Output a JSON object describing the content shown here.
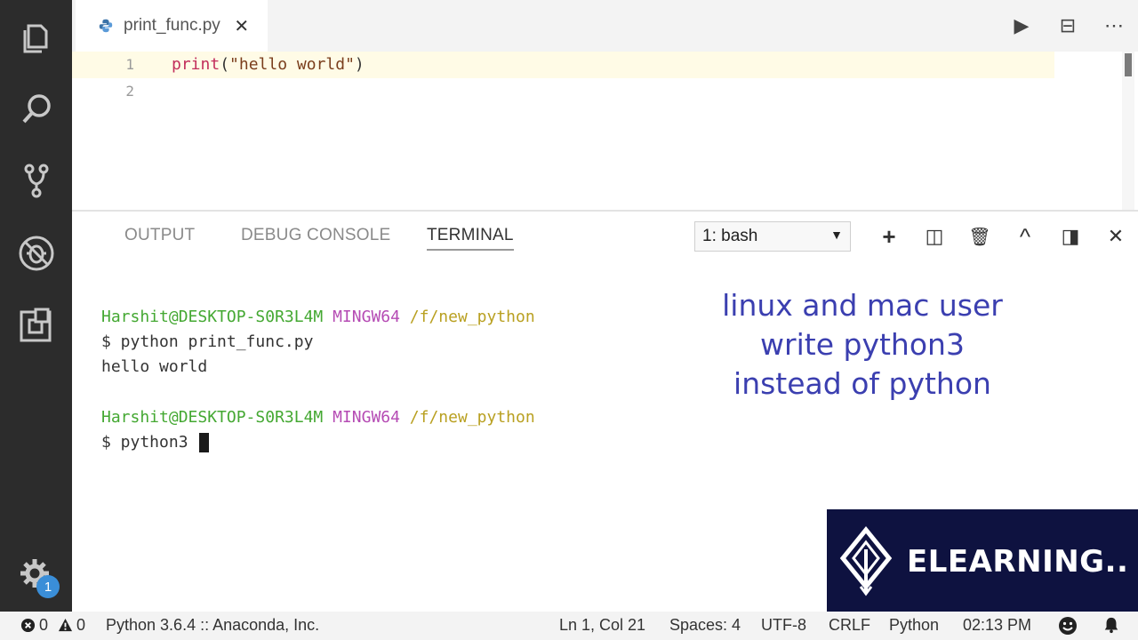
{
  "editor_tab": {
    "filename": "print_func.py",
    "close_glyph": "✕"
  },
  "editor_actions": [
    {
      "name": "run-icon",
      "glyph": "▶"
    },
    {
      "name": "split-editor-icon",
      "glyph": "⊟"
    },
    {
      "name": "more-actions-icon",
      "glyph": "⋯"
    }
  ],
  "editor": {
    "lines": [
      {
        "number": "1",
        "func": "print",
        "open": "(",
        "string": "\"hello world\"",
        "close": ")"
      },
      {
        "number": "2"
      }
    ]
  },
  "panel": {
    "tabs": [
      "OUTPUT",
      "DEBUG CONSOLE",
      "TERMINAL"
    ],
    "active_tab": "TERMINAL",
    "terminal_select": "1: bash",
    "select_caret": "▼"
  },
  "panel_actions": [
    {
      "name": "new-terminal-icon",
      "glyph": "+"
    },
    {
      "name": "split-terminal-icon",
      "glyph": "◫"
    },
    {
      "name": "kill-terminal-icon",
      "glyph": "🗑"
    },
    {
      "name": "maximize-panel-icon",
      "glyph": "^"
    },
    {
      "name": "toggle-panel-position-icon",
      "glyph": "◨"
    },
    {
      "name": "close-panel-icon",
      "glyph": "✕"
    }
  ],
  "terminal": {
    "prompt1": {
      "user": "Harshit@DESKTOP-S0R3L4M",
      "system": "MINGW64",
      "path": "/f/new_python"
    },
    "command1": "$ python print_func.py",
    "output1": "hello world",
    "prompt2": {
      "user": "Harshit@DESKTOP-S0R3L4M",
      "system": "MINGW64",
      "path": "/f/new_python"
    },
    "command2": "$ python3 "
  },
  "overlay": {
    "line1": "linux and mac user",
    "line2": "write python3",
    "line3": "instead of python"
  },
  "watermark": {
    "text": "ELEARNING..."
  },
  "activity_bar": {
    "settings_badge": "1"
  },
  "status_bar": {
    "errors": "0",
    "warnings": "0",
    "interpreter": "Python 3.6.4 :: Anaconda, Inc.",
    "cursor_position": "Ln 1, Col 21",
    "indentation": "Spaces: 4",
    "encoding": "UTF-8",
    "line_ending": "CRLF",
    "language": "Python",
    "time": "02:13 PM"
  }
}
